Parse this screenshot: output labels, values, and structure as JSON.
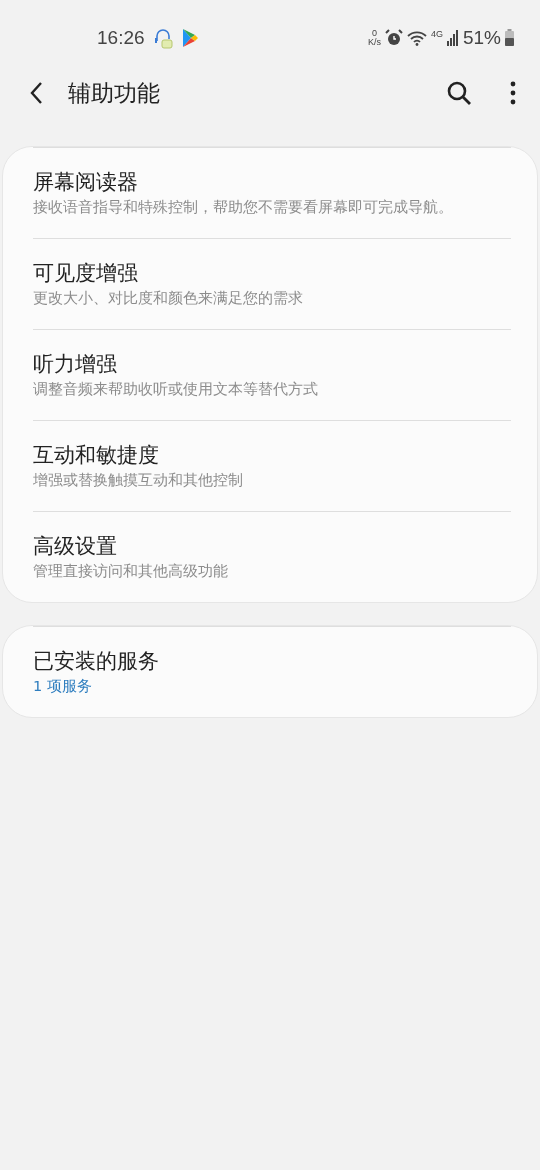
{
  "status_bar": {
    "time": "16:26",
    "net_speed_value": "0",
    "net_speed_unit": "K/s",
    "network": "4G",
    "battery": "51%"
  },
  "header": {
    "title": "辅助功能"
  },
  "groups": [
    {
      "items": [
        {
          "kind": "setting",
          "title": "屏幕阅读器",
          "subtitle": "接收语音指导和特殊控制，帮助您不需要看屏幕即可完成导航。"
        },
        {
          "kind": "setting",
          "title": "可见度增强",
          "subtitle": "更改大小、对比度和颜色来满足您的需求"
        },
        {
          "kind": "setting",
          "title": "听力增强",
          "subtitle": "调整音频来帮助收听或使用文本等替代方式"
        },
        {
          "kind": "setting",
          "title": "互动和敏捷度",
          "subtitle": "增强或替换触摸互动和其他控制"
        },
        {
          "kind": "setting",
          "title": "高级设置",
          "subtitle": "管理直接访问和其他高级功能"
        }
      ]
    },
    {
      "items": [
        {
          "kind": "summary",
          "title": "已安装的服务",
          "subtitle": "1 项服务"
        }
      ]
    }
  ]
}
